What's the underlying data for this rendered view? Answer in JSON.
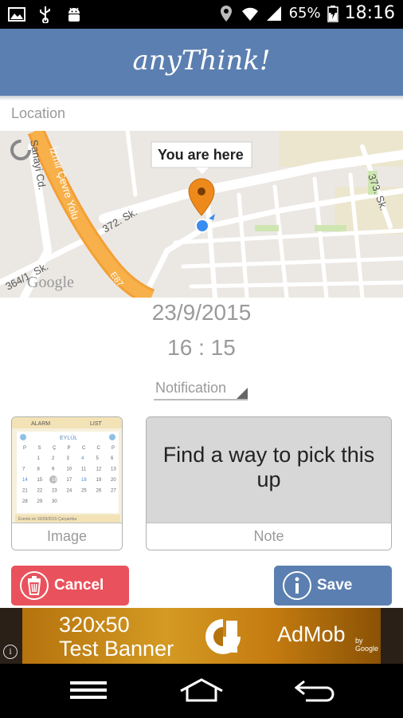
{
  "status_bar": {
    "battery_percent": "65%",
    "time": "18:16",
    "icons": [
      "image-icon",
      "usb-icon",
      "android-icon",
      "location-icon",
      "wifi-icon",
      "signal-icon",
      "battery-charging-icon"
    ]
  },
  "app": {
    "title": "anyThink!",
    "brand_color": "#5b7fb0"
  },
  "location": {
    "label": "Location",
    "marker_callout": "You are here",
    "map_labels": {
      "street_1": "Sanayi Cd.",
      "street_2": "İzmir Çevre Yolu",
      "street_3": "372. Sk.",
      "street_4": "373. Sk.",
      "street_5": "364/1. Sk.",
      "highway": "E87",
      "map_brand": "Google"
    }
  },
  "date": "23/9/2015",
  "time": "16 : 15",
  "notification": {
    "label": "Notification"
  },
  "image_card": {
    "caption": "Image",
    "calendar": {
      "tab_left": "ALARM",
      "tab_right": "LIST",
      "month": "EYLÜL",
      "weekdays": [
        "P",
        "S",
        "Ç",
        "P",
        "C",
        "C",
        "P"
      ],
      "days": [
        "",
        "1",
        "2",
        "3",
        "4",
        "5",
        "6",
        "7",
        "8",
        "9",
        "10",
        "11",
        "12",
        "13",
        "14",
        "15",
        "16",
        "17",
        "18",
        "19",
        "20",
        "21",
        "22",
        "23",
        "24",
        "25",
        "26",
        "27",
        "28",
        "29",
        "30",
        "",
        "",
        "",
        ""
      ],
      "footer": "Events on 16/09/2015 Çarşamba"
    }
  },
  "note_card": {
    "text": "Find a way to pick this up",
    "caption": "Note"
  },
  "buttons": {
    "cancel": "Cancel",
    "save": "Save",
    "cancel_color": "#e9525c",
    "save_color": "#5b7fb0"
  },
  "ad": {
    "line1": "320x50",
    "line2": "Test Banner",
    "brand": "AdMob",
    "by": "by Google"
  },
  "nav_bar": {
    "icons": [
      "menu-icon",
      "home-icon",
      "back-icon"
    ]
  }
}
